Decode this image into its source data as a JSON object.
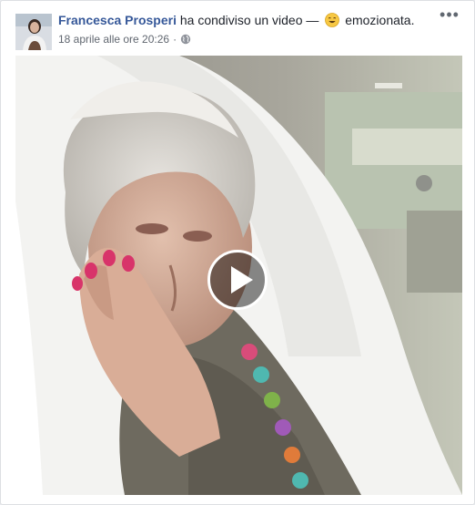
{
  "post": {
    "author": "Francesca Prosperi",
    "action_text": "ha condiviso un video",
    "separator": "—",
    "feeling_emoji": "smiling-face-icon",
    "feeling": "emozionata.",
    "timestamp": "18 aprile alle ore 20:26",
    "dot": "·",
    "privacy_icon": "globe-icon",
    "menu_glyph": "•••"
  },
  "video": {
    "play_icon": "play-icon",
    "accent": "#365899"
  }
}
